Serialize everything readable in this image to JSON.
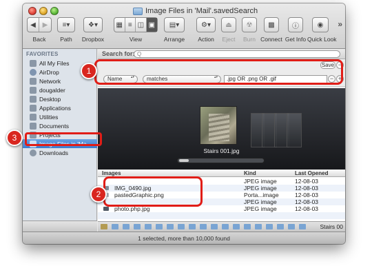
{
  "window": {
    "title": "Image Files in 'Mail'.savedSearch"
  },
  "toolbar": {
    "back_label": "Back",
    "path_label": "Path",
    "dropbox_label": "Dropbox",
    "view_label": "View",
    "arrange_label": "Arrange",
    "action_label": "Action",
    "eject_label": "Eject",
    "burn_label": "Burn",
    "connect_label": "Connect",
    "getinfo_label": "Get Info",
    "quicklook_label": "Quick Look",
    "overflow": "»"
  },
  "sidebar": {
    "header": "FAVORITES",
    "items": [
      {
        "label": "All My Files",
        "icon": "all-files-icon"
      },
      {
        "label": "AirDrop",
        "icon": "airdrop-icon"
      },
      {
        "label": "Network",
        "icon": "network-icon"
      },
      {
        "label": "dougalder",
        "icon": "home-icon"
      },
      {
        "label": "Desktop",
        "icon": "desktop-icon"
      },
      {
        "label": "Applications",
        "icon": "applications-icon"
      },
      {
        "label": "Utilities",
        "icon": "utilities-icon"
      },
      {
        "label": "Documents",
        "icon": "documents-icon"
      },
      {
        "label": "Projects",
        "icon": "folder-icon"
      },
      {
        "label": "Image Files in 'Ma...",
        "icon": "smart-folder-icon",
        "selected": true
      },
      {
        "label": "Downloads",
        "icon": "downloads-icon"
      }
    ]
  },
  "search": {
    "label": "Search for:",
    "placeholder": "Q",
    "save_label": "Save"
  },
  "rule": {
    "attribute": "Name",
    "operator": "matches",
    "value": ".jpg OR .png OR .gif"
  },
  "coverflow": {
    "caption": "Stairs 001.jpg"
  },
  "list": {
    "headers": {
      "name": "Images",
      "kind": "Kind",
      "date": "Last Opened"
    },
    "rows": [
      {
        "name": "",
        "kind": "JPEG image",
        "date": "12-08-03"
      },
      {
        "name": "IMG_0490.jpg",
        "kind": "JPEG image",
        "date": "12-08-03"
      },
      {
        "name": "pastedGraphic.png",
        "kind": "Porta...image",
        "date": "12-08-03"
      },
      {
        "name": "",
        "kind": "JPEG image",
        "date": "12-08-03"
      },
      {
        "name": "photo.php.jpg",
        "kind": "JPEG image",
        "date": "12-08-03"
      }
    ]
  },
  "pathbar": {
    "end_label": "Stairs 00"
  },
  "status": {
    "text": "1 selected, more than 10,000 found"
  },
  "callouts": [
    "1",
    "2",
    "3"
  ],
  "colors": {
    "callout_red": "#d9261f",
    "selection_blue": "#3b7bd0"
  }
}
